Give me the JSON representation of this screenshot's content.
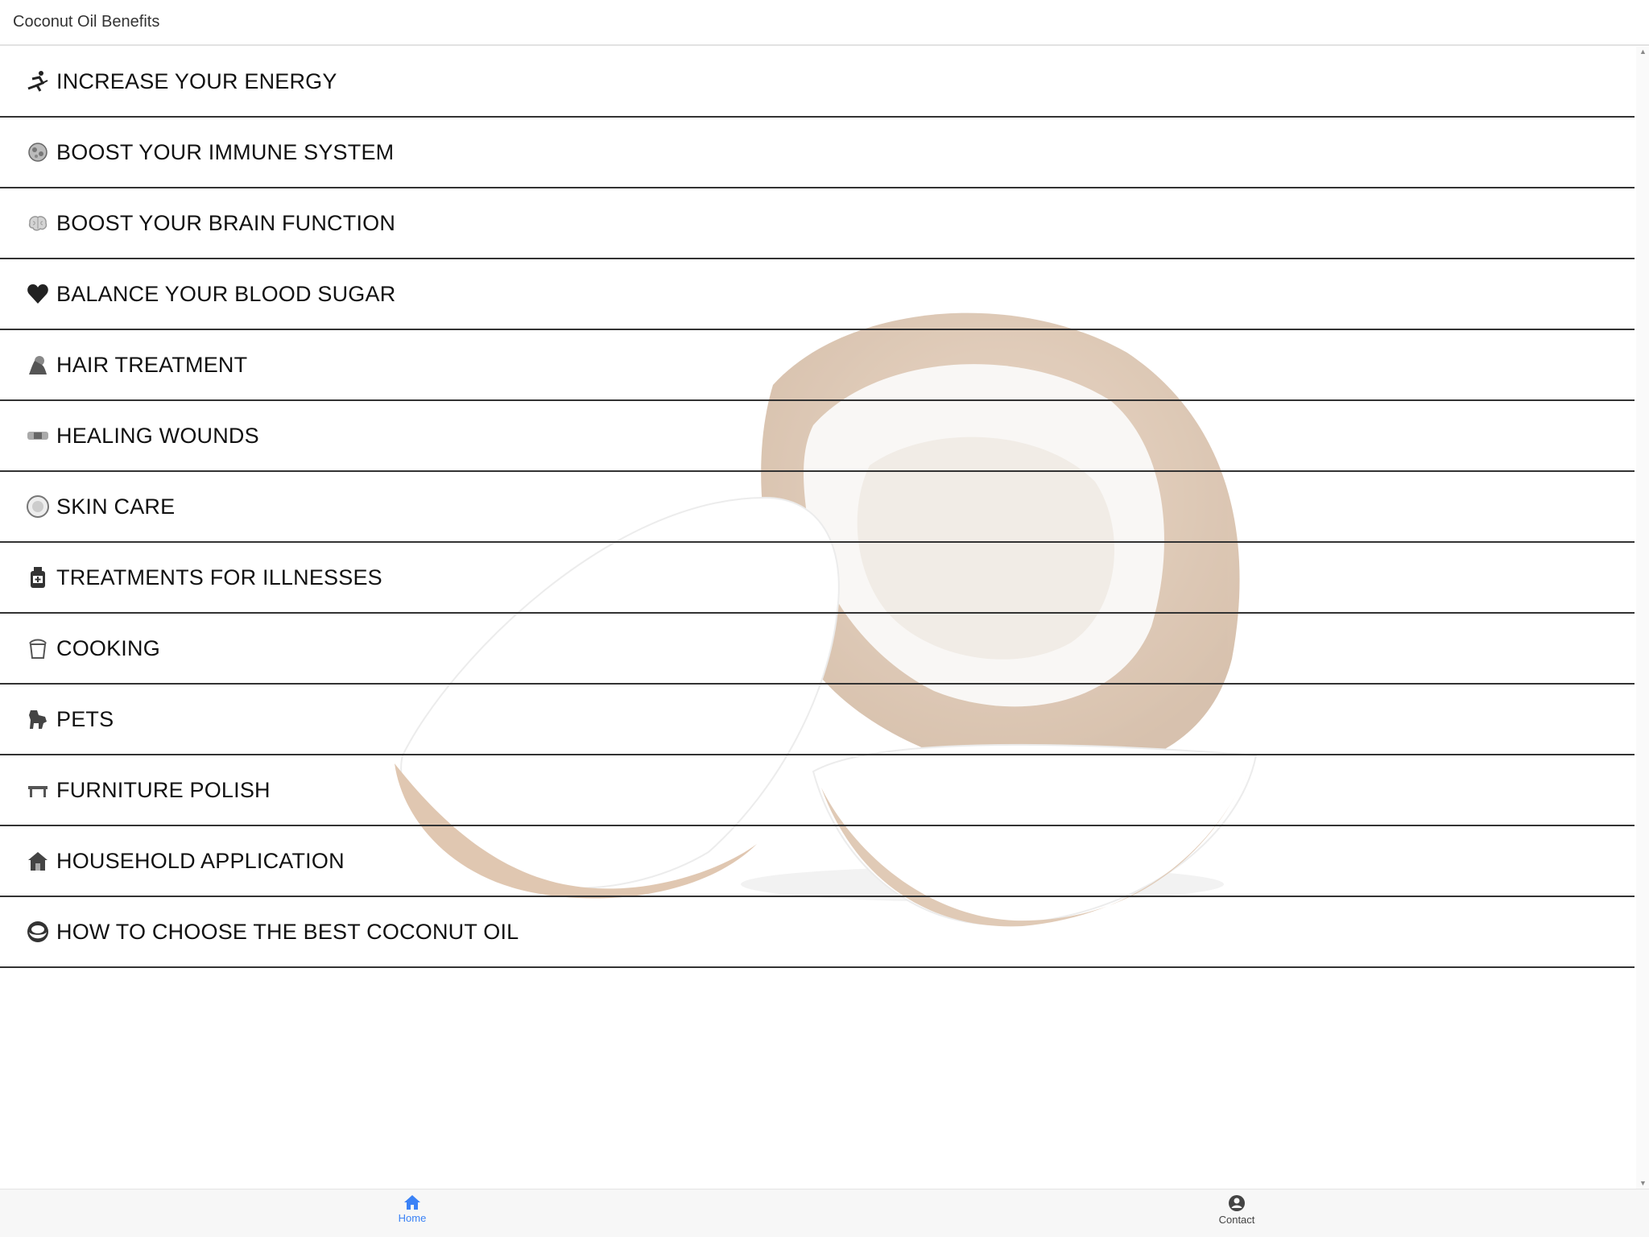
{
  "header": {
    "title": "Coconut Oil Benefits"
  },
  "menu": {
    "items": [
      {
        "label": "INCREASE YOUR ENERGY",
        "icon": "runner-icon"
      },
      {
        "label": "BOOST YOUR IMMUNE SYSTEM",
        "icon": "virus-icon"
      },
      {
        "label": "BOOST YOUR BRAIN FUNCTION",
        "icon": "brain-icon"
      },
      {
        "label": "BALANCE YOUR BLOOD SUGAR",
        "icon": "heart-icon"
      },
      {
        "label": "HAIR TREATMENT",
        "icon": "hair-icon"
      },
      {
        "label": "HEALING WOUNDS",
        "icon": "bandage-icon"
      },
      {
        "label": "SKIN CARE",
        "icon": "cream-jar-icon"
      },
      {
        "label": "TREATMENTS FOR ILLNESSES",
        "icon": "medicine-bottle-icon"
      },
      {
        "label": "COOKING",
        "icon": "cooking-pot-icon"
      },
      {
        "label": "PETS",
        "icon": "dog-icon"
      },
      {
        "label": "FURNITURE POLISH",
        "icon": "table-icon"
      },
      {
        "label": "HOUSEHOLD APPLICATION",
        "icon": "house-icon"
      },
      {
        "label": "HOW TO CHOOSE THE BEST COCONUT OIL",
        "icon": "coconut-icon"
      }
    ]
  },
  "tabs": {
    "home": {
      "label": "Home",
      "icon": "home-icon",
      "active": true
    },
    "contact": {
      "label": "Contact",
      "icon": "user-circle-icon",
      "active": false
    }
  },
  "colors": {
    "accent": "#3b82f6",
    "divider": "#333333"
  }
}
